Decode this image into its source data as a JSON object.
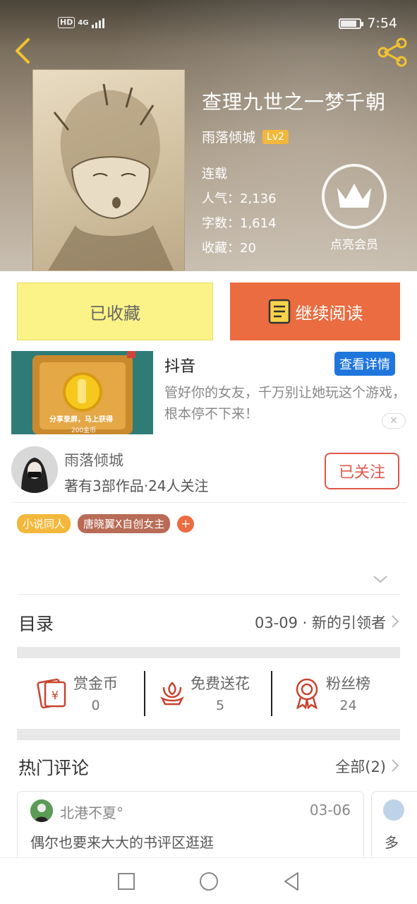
{
  "status_bar": {
    "network_hd": "HD",
    "network_type": "4G",
    "time": "7:54"
  },
  "book": {
    "title": "查理九世之一梦千朝",
    "author": "雨落倾城",
    "level": "Lv2",
    "status": "连载",
    "popularity": "人气：2,136",
    "word_count": "字数：1,614",
    "favorites": "收藏：20",
    "vip_label": "点亮会员"
  },
  "actions": {
    "collected_label": "已收藏",
    "read_label": "继续阅读"
  },
  "ad": {
    "title": "抖音",
    "button": "查看详情",
    "description": "管好你的女友，千万别让她玩这个游戏，根本停不下来！",
    "image_text": "分享录屏，马上获得",
    "image_subtext": "200金币"
  },
  "author_info": {
    "name": "雨落倾城",
    "stats": "著有3部作品·24人关注",
    "follow_label": "已关注"
  },
  "tags": [
    "小说同人",
    "唐晓翼X自创女主"
  ],
  "toc": {
    "title": "目录",
    "latest": "03-09 · 新的引领者"
  },
  "support": [
    {
      "label": "赏金币",
      "count": "0",
      "icon": "red-envelope-icon"
    },
    {
      "label": "免费送花",
      "count": "5",
      "icon": "flower-icon"
    },
    {
      "label": "粉丝榜",
      "count": "24",
      "icon": "medal-icon"
    }
  ],
  "comments": {
    "title": "热门评论",
    "all_label": "全部(2)",
    "items": [
      {
        "user": "北港不夏°",
        "date": "03-06",
        "text": "偶尔也要来大大的书评区逛逛"
      },
      {
        "text": "多"
      }
    ]
  },
  "colors": {
    "accent_orange": "#ea6c40",
    "collected_yellow": "#fbf387",
    "level_gold": "#f3b83b",
    "ad_blue": "#1f76dc",
    "follow_red": "#e0574a"
  }
}
